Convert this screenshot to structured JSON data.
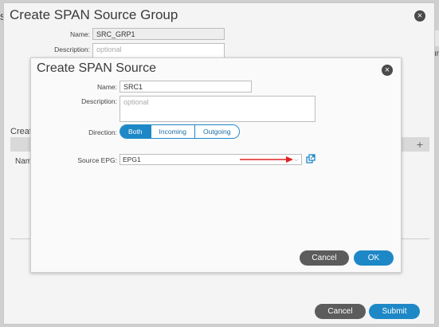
{
  "background": {
    "left_text": "s",
    "right_text": "ur"
  },
  "outer_dialog": {
    "title": "Create SPAN Source Group",
    "close": "×",
    "name_label": "Name:",
    "name_value": "SRC_GRP1",
    "description_label": "Description:",
    "description_placeholder": "optional",
    "section_title": "Creat",
    "table_add": "+",
    "table_col": "Nam",
    "cancel_label": "Cancel",
    "submit_label": "Submit"
  },
  "inner_dialog": {
    "title": "Create SPAN Source",
    "close": "×",
    "name_label": "Name:",
    "name_value": "SRC1",
    "description_label": "Description:",
    "description_placeholder": "optional",
    "direction_label": "Direction:",
    "direction_options": [
      "Both",
      "Incoming",
      "Outgoing"
    ],
    "direction_selected": "Both",
    "source_epg_label": "Source EPG:",
    "source_epg_value": "EPG1",
    "chevron": "⌵",
    "cancel_label": "Cancel",
    "ok_label": "OK"
  },
  "colors": {
    "accent": "#1e88c7",
    "arrow": "#e02020",
    "cancel_button": "#5c5c5c"
  }
}
